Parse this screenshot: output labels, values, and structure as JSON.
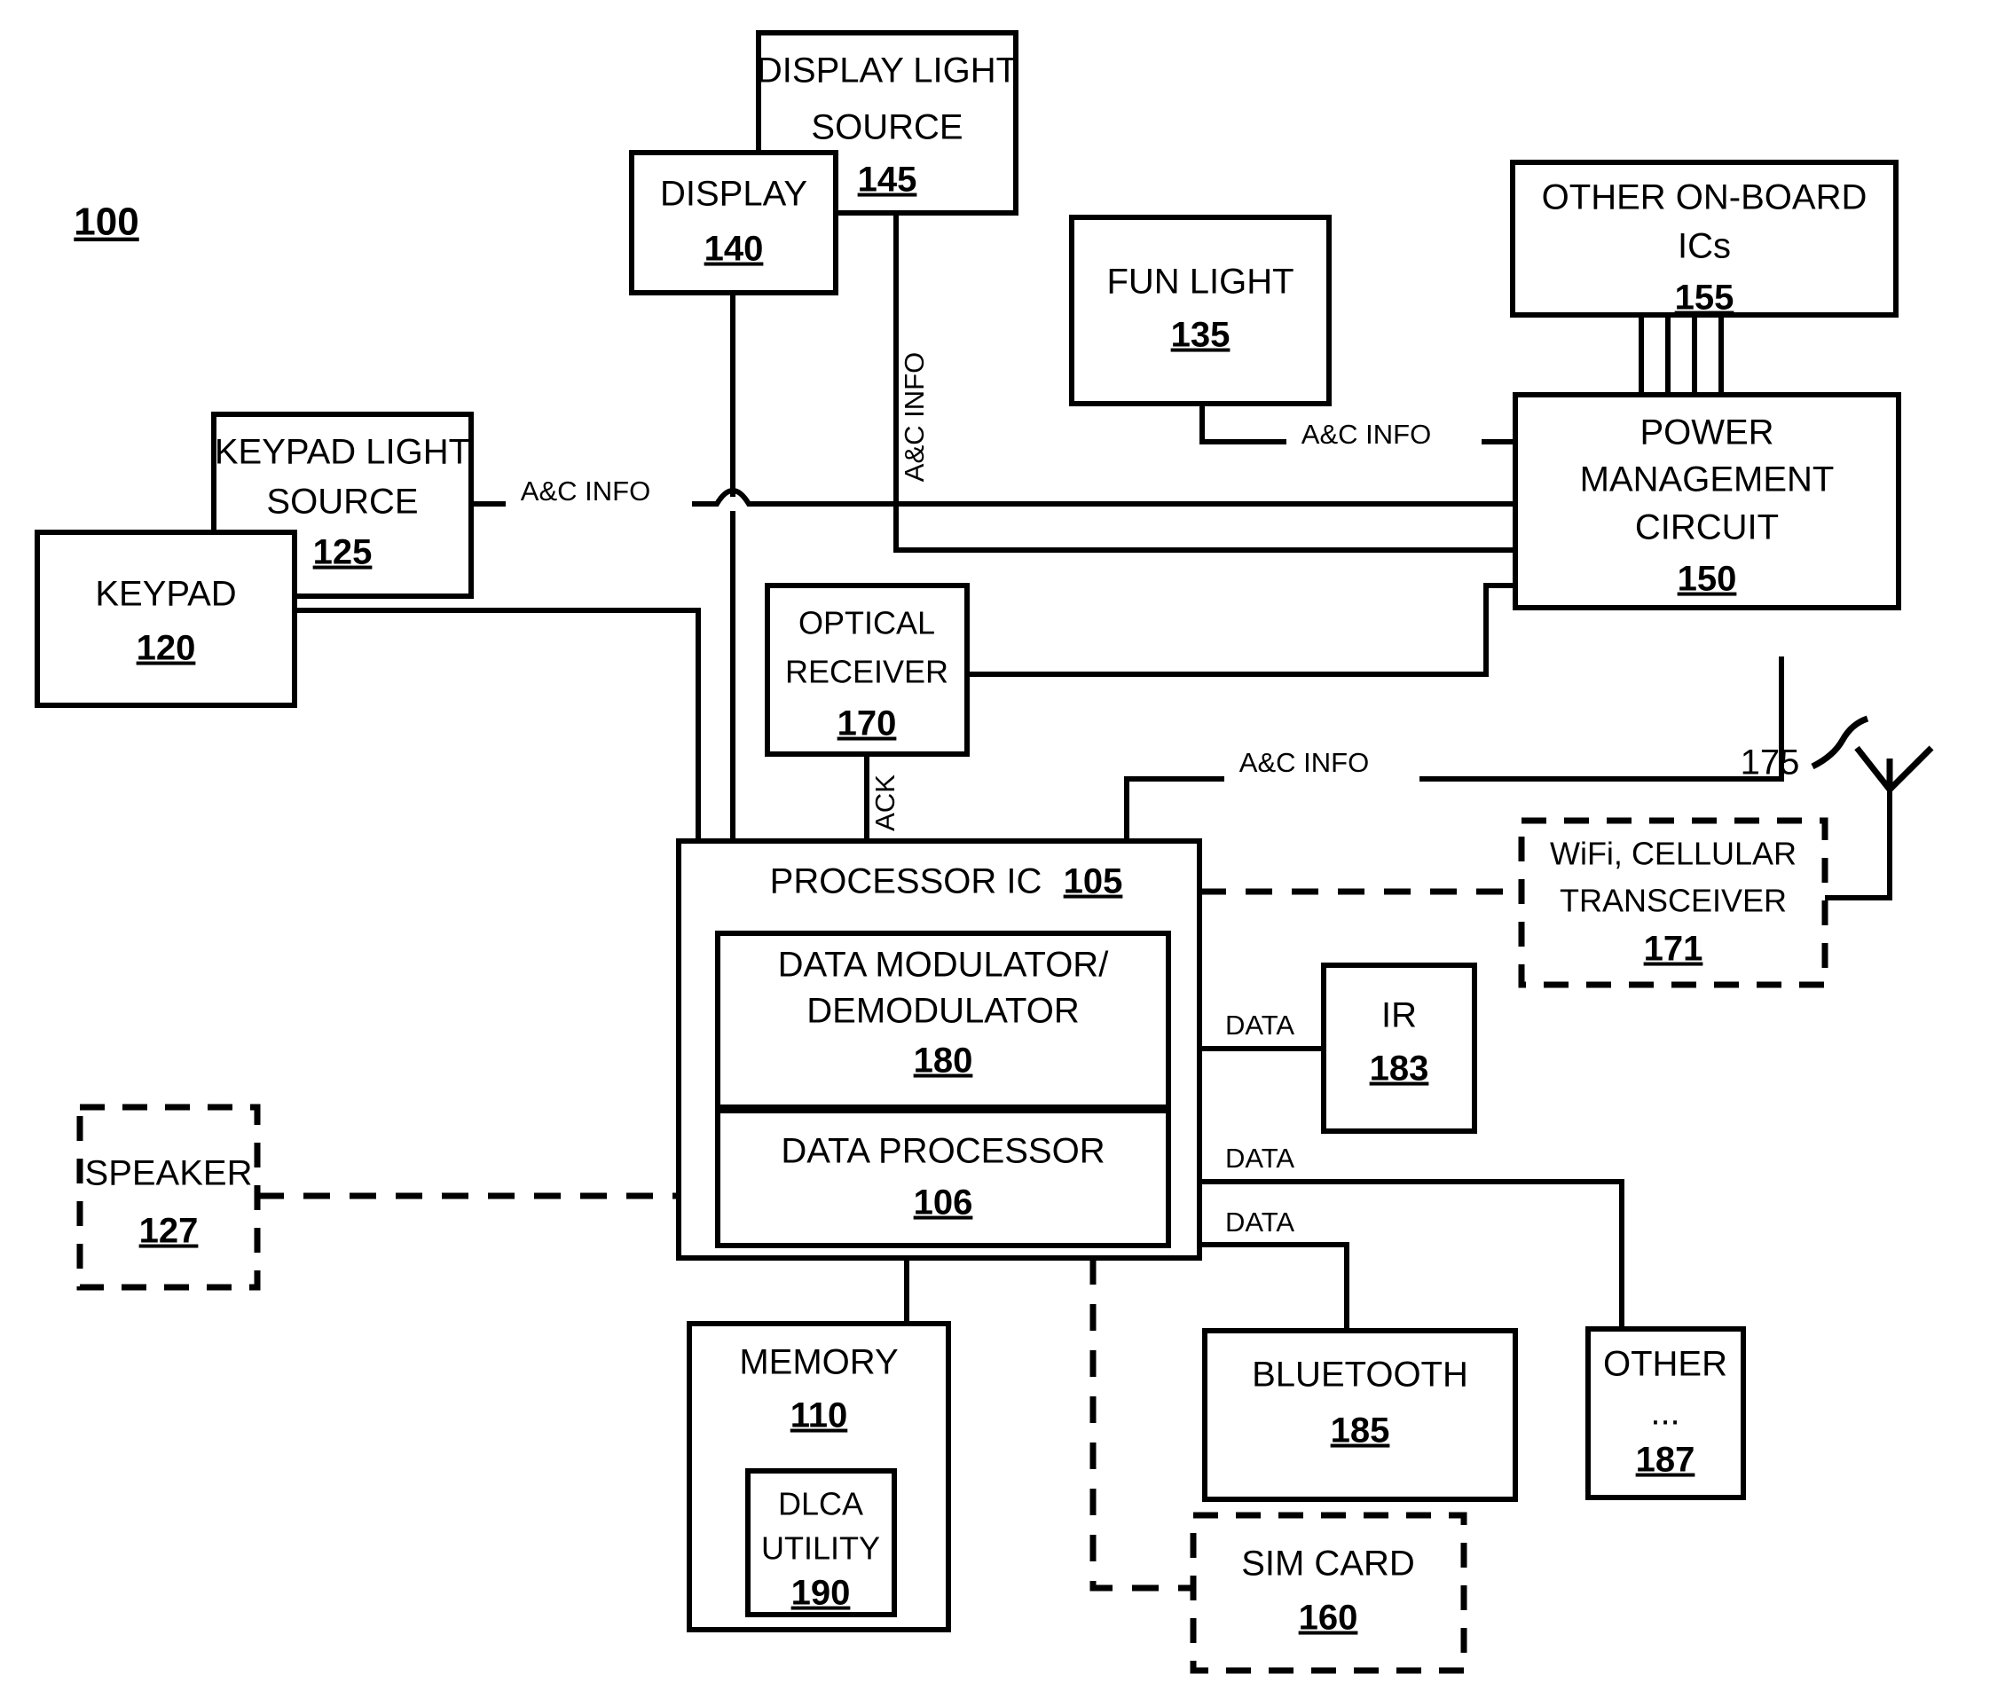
{
  "figure": {
    "number": "100",
    "title": ""
  },
  "blocks": [
    {
      "id": "display_light_source",
      "lines": [
        "DISPLAY LIGHT",
        "SOURCE"
      ],
      "ref": "145",
      "style": "solid"
    },
    {
      "id": "display",
      "lines": [
        "DISPLAY"
      ],
      "ref": "140",
      "style": "solid"
    },
    {
      "id": "fun_light",
      "lines": [
        "FUN LIGHT"
      ],
      "ref": "135",
      "style": "solid"
    },
    {
      "id": "other_on_board_ics",
      "lines": [
        "OTHER ON-BOARD",
        "ICs"
      ],
      "ref": "155",
      "style": "solid"
    },
    {
      "id": "power_management_circuit",
      "lines": [
        "POWER",
        "MANAGEMENT",
        "CIRCUIT"
      ],
      "ref": "150",
      "style": "solid"
    },
    {
      "id": "keypad_light_source",
      "lines": [
        "KEYPAD LIGHT",
        "SOURCE"
      ],
      "ref": "125",
      "style": "solid"
    },
    {
      "id": "keypad",
      "lines": [
        "KEYPAD"
      ],
      "ref": "120",
      "style": "solid"
    },
    {
      "id": "optical_receiver",
      "lines": [
        "OPTICAL",
        "RECEIVER"
      ],
      "ref": "170",
      "style": "solid"
    },
    {
      "id": "wifi_cellular_transceiver",
      "lines": [
        "WiFi, CELLULAR",
        "TRANSCEIVER"
      ],
      "ref": "171",
      "style": "dashed"
    },
    {
      "id": "processor_ic",
      "lines": [
        "PROCESSOR IC"
      ],
      "ref": "105",
      "style": "solid"
    },
    {
      "id": "data_modulator_demodulator",
      "lines": [
        "DATA MODULATOR/",
        "DEMODULATOR"
      ],
      "ref": "180",
      "style": "solid"
    },
    {
      "id": "data_processor",
      "lines": [
        "DATA PROCESSOR"
      ],
      "ref": "106",
      "style": "solid"
    },
    {
      "id": "speaker",
      "lines": [
        "SPEAKER"
      ],
      "ref": "127",
      "style": "dashed"
    },
    {
      "id": "memory",
      "lines": [
        "MEMORY"
      ],
      "ref": "110",
      "style": "solid"
    },
    {
      "id": "dlca_utility",
      "lines": [
        "DLCA",
        "UTILITY"
      ],
      "ref": "190",
      "style": "solid"
    },
    {
      "id": "ir",
      "lines": [
        "IR"
      ],
      "ref": "183",
      "style": "solid"
    },
    {
      "id": "bluetooth",
      "lines": [
        "BLUETOOTH"
      ],
      "ref": "185",
      "style": "solid"
    },
    {
      "id": "other",
      "lines": [
        "OTHER",
        "..."
      ],
      "ref": "187",
      "style": "solid"
    },
    {
      "id": "sim_card",
      "lines": [
        "SIM CARD"
      ],
      "ref": "160",
      "style": "dashed"
    }
  ],
  "labels": {
    "display_light_source_l1": "DISPLAY LIGHT",
    "display_light_source_l2": "SOURCE",
    "display_light_source_ref": "145",
    "display_l1": "DISPLAY",
    "display_ref": "140",
    "fun_light_l1": "FUN LIGHT",
    "fun_light_ref": "135",
    "other_ics_l1": "OTHER ON-BOARD",
    "other_ics_l2": "ICs",
    "other_ics_ref": "155",
    "pmc_l1": "POWER",
    "pmc_l2": "MANAGEMENT",
    "pmc_l3": "CIRCUIT",
    "pmc_ref": "150",
    "kls_l1": "KEYPAD LIGHT",
    "kls_l2": "SOURCE",
    "kls_ref": "125",
    "keypad_l1": "KEYPAD",
    "keypad_ref": "120",
    "optrx_l1": "OPTICAL",
    "optrx_l2": "RECEIVER",
    "optrx_ref": "170",
    "wifi_l1": "WiFi, CELLULAR",
    "wifi_l2": "TRANSCEIVER",
    "wifi_ref": "171",
    "proc_l1": "PROCESSOR IC",
    "proc_ref": "105",
    "dmd_l1": "DATA MODULATOR/",
    "dmd_l2": "DEMODULATOR",
    "dmd_ref": "180",
    "dp_l1": "DATA PROCESSOR",
    "dp_ref": "106",
    "speaker_l1": "SPEAKER",
    "speaker_ref": "127",
    "memory_l1": "MEMORY",
    "memory_ref": "110",
    "dlca_l1": "DLCA",
    "dlca_l2": "UTILITY",
    "dlca_ref": "190",
    "ir_l1": "IR",
    "ir_ref": "183",
    "bt_l1": "BLUETOOTH",
    "bt_ref": "185",
    "other_l1": "OTHER",
    "other_l2": "...",
    "other_ref": "187",
    "sim_l1": "SIM CARD",
    "sim_ref": "160",
    "antenna_ref": "175",
    "figure_ref": "100"
  },
  "wire_labels": {
    "ac_info_keypad": "A&C INFO",
    "ac_info_display": "A&C INFO",
    "ac_info_funlight": "A&C INFO",
    "ac_info_wifi": "A&C INFO",
    "ack": "ACK",
    "data_ir": "DATA",
    "data_other": "DATA",
    "data_bluetooth": "DATA"
  },
  "colors": {
    "stroke": "#000000",
    "background": "#ffffff"
  }
}
